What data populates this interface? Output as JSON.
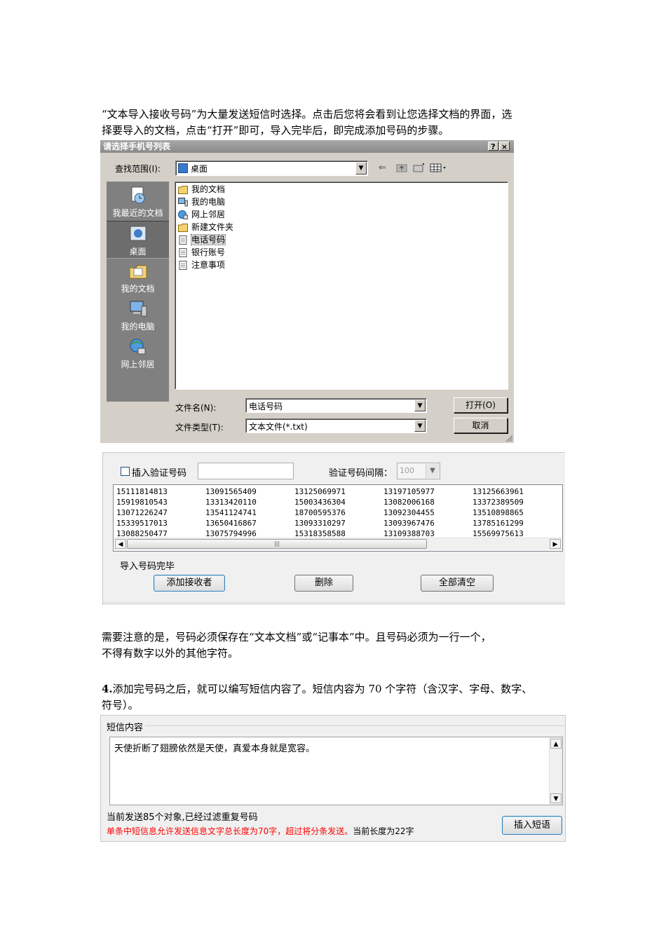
{
  "paragraphs": {
    "p1_line1": "“文本导入接收号码”为大量发送短信时选择。点击后您将会看到让您选择文档的界面，选",
    "p1_line2": "择要导入的文档，点击“打开”即可，导入完毕后，即完成添加号码的步骤。",
    "p2_line1": "需要注意的是，号码必须保存在“文本文档”或“记事本”中。且号码必须为一行一个，",
    "p2_line2": "不得有数字以外的其他字符。",
    "p3_num": "4.",
    "p3_line1": "添加完号码之后，就可以编写短信内容了。短信内容为 70 个字符（含汉字、字母、数字、",
    "p3_line2": "符号）。"
  },
  "dialog": {
    "title": "请选择手机号列表",
    "help_btn": "?",
    "close_btn": "×",
    "lookin_label": "查找范围(I):",
    "lookin_value": "桌面",
    "places": [
      {
        "label": "我最近的文档",
        "icon": "recent-documents-icon"
      },
      {
        "label": "桌面",
        "icon": "desktop-icon"
      },
      {
        "label": "我的文档",
        "icon": "my-documents-icon"
      },
      {
        "label": "我的电脑",
        "icon": "my-computer-icon"
      },
      {
        "label": "网上邻居",
        "icon": "network-places-icon"
      }
    ],
    "files": [
      {
        "name": "我的文档",
        "icon": "folder-icon"
      },
      {
        "name": "我的电脑",
        "icon": "computer-icon"
      },
      {
        "name": "网上邻居",
        "icon": "network-icon"
      },
      {
        "name": "新建文件夹",
        "icon": "folder-icon"
      },
      {
        "name": "电话号码",
        "icon": "text-file-icon"
      },
      {
        "name": "银行账号",
        "icon": "text-file-icon"
      },
      {
        "name": "注意事项",
        "icon": "text-file-icon"
      }
    ],
    "selected_file": "电话号码",
    "filename_label": "文件名(N):",
    "filename_value": "电话号码",
    "filetype_label": "文件类型(T):",
    "filetype_value": "文本文件(*.txt)",
    "open_btn": "打开(O)",
    "cancel_btn": "取消"
  },
  "import_panel": {
    "insert_verify_label": "插入验证号码",
    "interval_label": "验证号码间隔：",
    "interval_value": "100",
    "numbers": [
      [
        "15111814813",
        "15919810543",
        "13071226247",
        "15339517013",
        "13088250477"
      ],
      [
        "13091565409",
        "13313420110",
        "13541124741",
        "13650416867",
        "13075794996"
      ],
      [
        "13125069971",
        "15003436304",
        "18700595376",
        "13093310297",
        "15318358588"
      ],
      [
        "13197105977",
        "13082006168",
        "13092304455",
        "13093967476",
        "13109388703"
      ],
      [
        "13125663961",
        "13372389509",
        "13510898865",
        "13785161299",
        "15569975613"
      ]
    ],
    "status": "导入号码完毕",
    "add_btn": "添加接收者",
    "delete_btn": "删除",
    "clear_btn": "全部清空"
  },
  "sms_panel": {
    "group_label": "短信内容",
    "message": "天使折断了翅膀依然是天使，真爱本身就是宽容。",
    "status_line": "当前发送85个对象,已经过滤重复号码",
    "warning": "单条中短信息允许发送信息文字总长度为70字，超过将分条发送。",
    "length_text": "当前长度为22字",
    "insert_phrase_btn": "插入短语"
  },
  "colors": {
    "dialog_bg": "#d4d0c8",
    "places_bg": "#808080",
    "warning_red": "#ff0000"
  }
}
